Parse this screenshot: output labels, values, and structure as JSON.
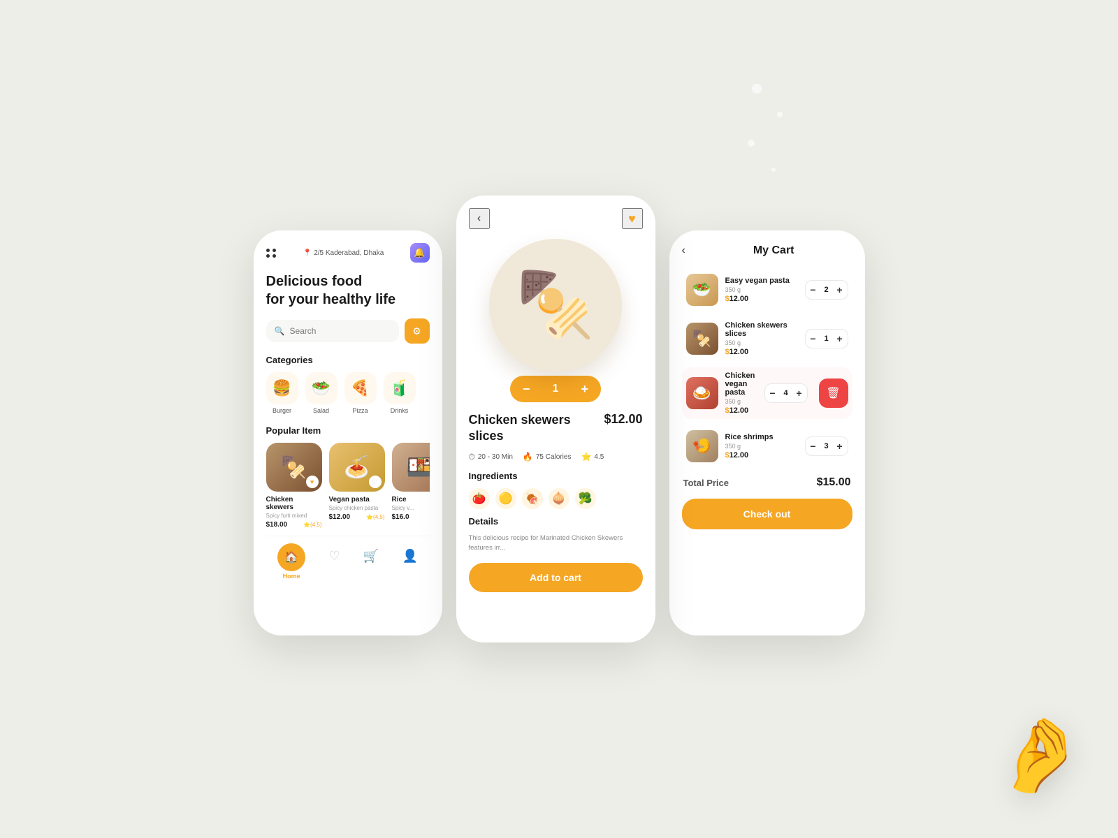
{
  "background": "#eeeee8",
  "phone_home": {
    "location": "2/5 Kaderabad, Dhaka",
    "headline_line1": "Delicious food",
    "headline_line2": "for your healthy life",
    "search_placeholder": "Search",
    "categories_title": "Categories",
    "categories": [
      {
        "label": "Burger",
        "icon": "🍔"
      },
      {
        "label": "Salad",
        "icon": "🥗"
      },
      {
        "label": "Pizza",
        "icon": "🍕"
      },
      {
        "label": "Drinks",
        "icon": "🧃"
      }
    ],
    "popular_title": "Popular Item",
    "popular_items": [
      {
        "name": "Chicken skewers",
        "sub": "Spicy furti mixed",
        "price": "$18.00",
        "rating": "(4.5)",
        "icon": "🍢"
      },
      {
        "name": "Vegan pasta",
        "sub": "Spicy chicken pasta",
        "price": "$12.00",
        "rating": "(4.5)",
        "icon": "🍝"
      },
      {
        "name": "Rice",
        "sub": "Spicy v...",
        "price": "$16.0",
        "icon": "🍱"
      }
    ],
    "nav_items": [
      "Home",
      "Heart",
      "Cart",
      "User"
    ]
  },
  "phone_detail": {
    "food_name": "Chicken skewers slices",
    "price": "$12.00",
    "quantity": "1",
    "time": "20 - 30 Min",
    "calories": "75 Calories",
    "rating": "4.5",
    "ingredients_title": "Ingredients",
    "ingredients": [
      "🍅",
      "🟡",
      "🍖",
      "🧅",
      "🥦"
    ],
    "details_title": "Details",
    "details_text": "This delicious recipe for Marinated Chicken Skewers features irr...",
    "add_to_cart": "Add to cart"
  },
  "phone_cart": {
    "title": "My Cart",
    "items": [
      {
        "name": "Easy vegan pasta",
        "weight": "350 g",
        "price": "$12.00",
        "qty": "2",
        "icon": "🥗"
      },
      {
        "name": "Chicken skewers slices",
        "weight": "350 g",
        "price": "$12.00",
        "qty": "1",
        "icon": "🍢"
      },
      {
        "name": "Chicken vegan pasta",
        "weight": "350 g",
        "price": "$12.00",
        "qty": "4",
        "icon": "🍛",
        "delete": true
      },
      {
        "name": "Rice shrimps",
        "weight": "350 g",
        "price": "$12.00",
        "qty": "3",
        "icon": "🍤"
      }
    ],
    "total_label": "Total Price",
    "total_price": "$15.00",
    "checkout": "Check out"
  },
  "accent_color": "#f5a623"
}
